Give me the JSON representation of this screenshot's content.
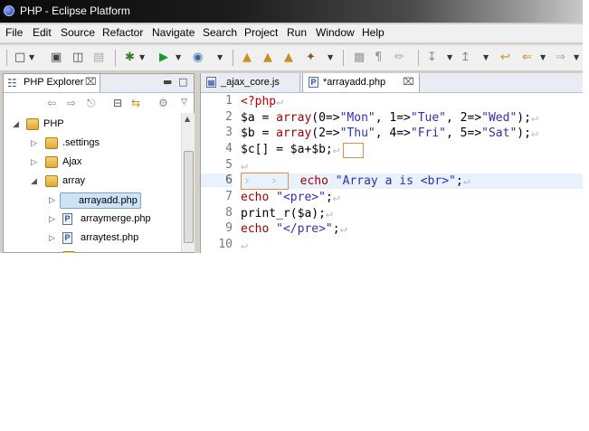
{
  "window": {
    "title": "PHP - Eclipse Platform"
  },
  "menu": [
    "File",
    "Edit",
    "Source",
    "Refactor",
    "Navigate",
    "Search",
    "Project",
    "Run",
    "Window",
    "Help"
  ],
  "explorer": {
    "tab_label": "PHP Explorer",
    "close_glyph": "⌧",
    "tree": [
      {
        "label": "PHP",
        "type": "project",
        "expanded": true
      },
      {
        "label": ".settings",
        "type": "folder",
        "expanded": false
      },
      {
        "label": "Ajax",
        "type": "folder",
        "expanded": false
      },
      {
        "label": "array",
        "type": "folder",
        "expanded": true
      },
      {
        "label": "arrayadd.php",
        "type": "php-file",
        "selected": true
      },
      {
        "label": "arraymerge.php",
        "type": "php-file"
      },
      {
        "label": "arraytest.php",
        "type": "php-file"
      }
    ]
  },
  "editor": {
    "tabs": [
      {
        "label": "_ajax_core.js",
        "active": false
      },
      {
        "label": "*arrayadd.php",
        "active": true
      }
    ],
    "line_numbers": [
      "1",
      "2",
      "3",
      "4",
      "5",
      "6",
      "7",
      "8",
      "9",
      "10"
    ],
    "current_line": "6",
    "code": {
      "l1": "<?php",
      "l2a": "$a = ",
      "l2b": "array",
      "l2c": "(0=>",
      "l2d": "\"Mon\"",
      "l2e": ", 1=>",
      "l2f": "\"Tue\"",
      "l2g": ", 2=>",
      "l2h": "\"Wed\"",
      "l2i": ");",
      "l3a": "$b = ",
      "l3b": "array",
      "l3c": "(2=>",
      "l3d": "\"Thu\"",
      "l3e": ", 4=>",
      "l3f": "\"Fri\"",
      "l3g": ", 5=>",
      "l3h": "\"Sat\"",
      "l3i": ");",
      "l4": "$c[] = $a+$b;",
      "l6a": "echo ",
      "l6b": "\"Array a is <br>\"",
      "l6c": ";",
      "l7a": "echo ",
      "l7b": "\"<pre>\"",
      "l7c": ";",
      "l8": "print_r($a);",
      "l9a": "echo ",
      "l9b": "\"</pre>\"",
      "l9c": ";",
      "eol": "↵",
      "tab_glyph": "›"
    }
  },
  "colors": {
    "keyword": "#a00000",
    "string": "#2f2fb0",
    "tag": "#c00000",
    "annotation_box": "#f08c3c",
    "selection": "#cde4f7"
  }
}
